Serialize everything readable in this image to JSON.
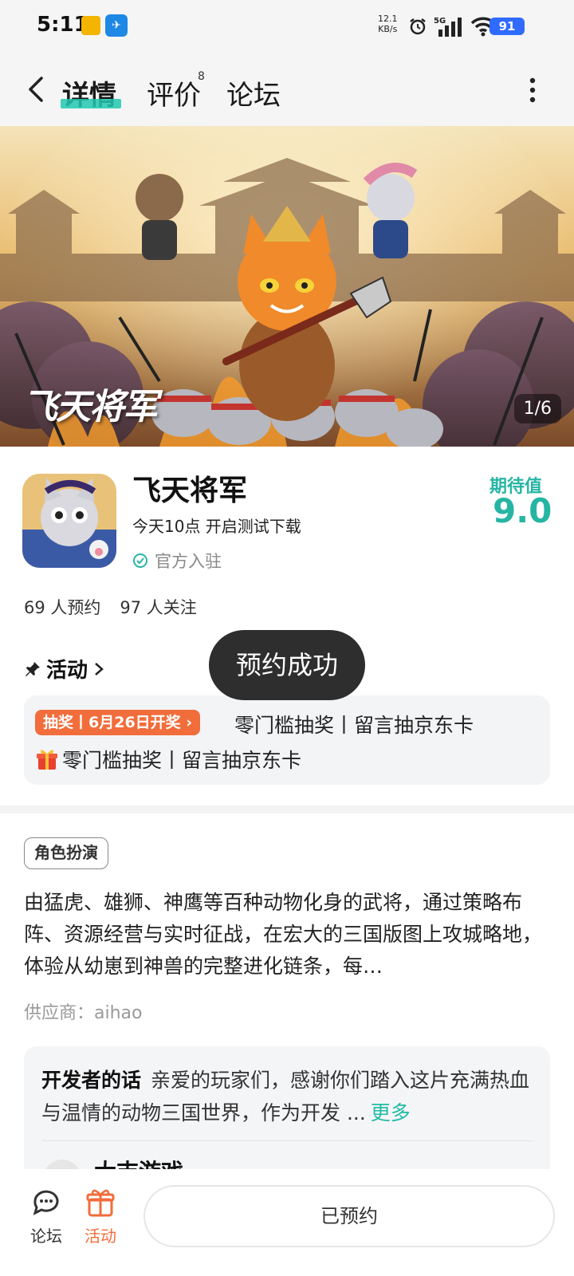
{
  "status_bar": {
    "time": "5:11",
    "net_speed_value": "12.1",
    "net_speed_unit": "KB/s",
    "network": "5G",
    "battery": "91"
  },
  "header": {
    "tabs": [
      {
        "label": "详情"
      },
      {
        "label": "评价",
        "badge": "8"
      },
      {
        "label": "论坛"
      }
    ]
  },
  "banner": {
    "logo_text": "飞天将军",
    "counter": "1/6"
  },
  "game": {
    "name": "飞天将军",
    "subtitle": "今天10点 开启测试下载",
    "official": "官方入驻",
    "expect_label": "期待值",
    "expect_score": "9.0",
    "reservations": "69 人预约",
    "followers": "97 人关注"
  },
  "activity": {
    "title": "活动",
    "badge": "抽奖丨6月26日开奖",
    "line1": "零门槛抽奖丨留言抽京东卡",
    "line2": "零门槛抽奖丨留言抽京东卡"
  },
  "toast": "预约成功",
  "description": {
    "genre": "角色扮演",
    "text": "由猛虎、雄狮、神鹰等百种动物化身的武将，通过策略布阵、资源经营与实时征战，在宏大的三国版图上攻城略地，体验从幼崽到神兽的完整进化链条，每…",
    "supplier": "供应商：aihao"
  },
  "developer": {
    "title": "开发者的话",
    "text": "亲爱的玩家们，感谢你们踏入这片充满热血与温情的动物三国世界，作为开发 ...",
    "more": "更多",
    "name": "大吉游戏"
  },
  "bottom_bar": {
    "forum": "论坛",
    "activity": "活动",
    "reserved": "已预约"
  },
  "colors": {
    "accent": "#27b5a3",
    "orange": "#f16d3b",
    "toast_bg": "#2e2e2e"
  }
}
